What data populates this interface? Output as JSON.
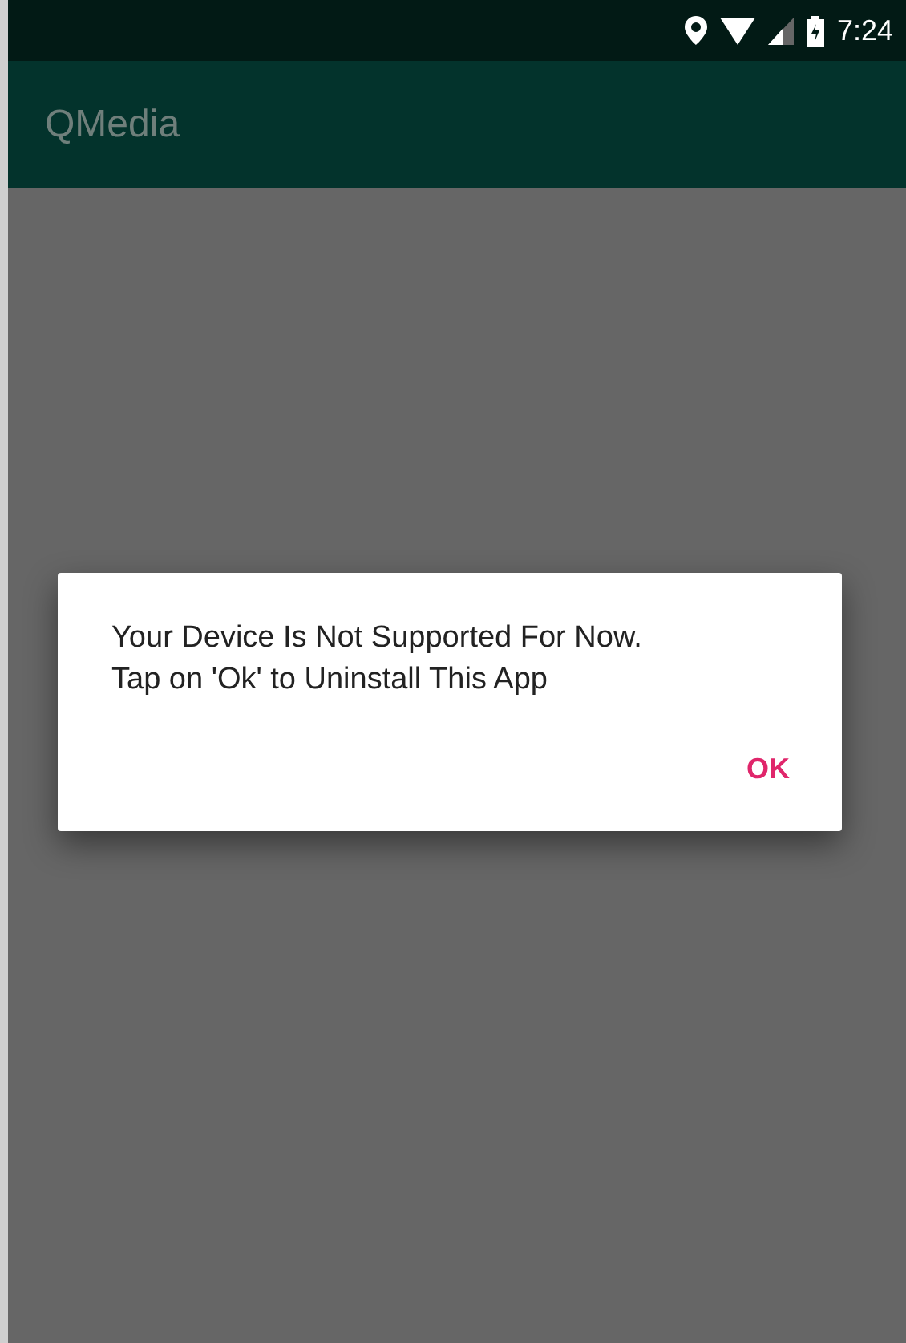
{
  "status_bar": {
    "time": "7:24"
  },
  "app_bar": {
    "title": "QMedia"
  },
  "dialog": {
    "message": "Your Device Is Not Supported For Now.\nTap on 'Ok' to Uninstall This App",
    "buttons": [
      "OK"
    ]
  }
}
